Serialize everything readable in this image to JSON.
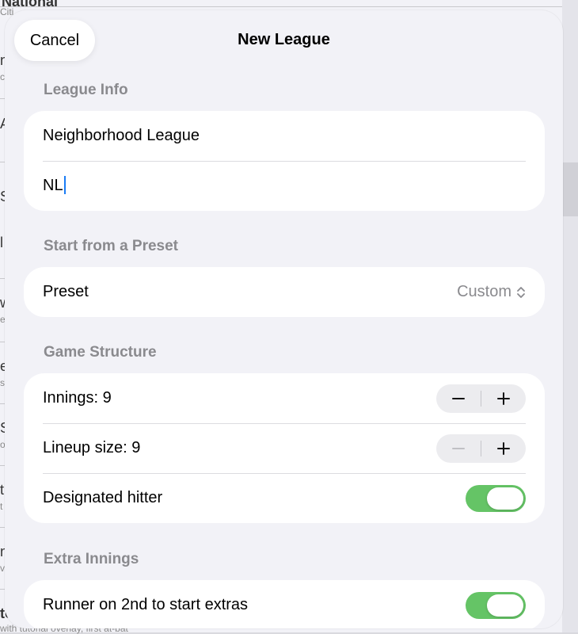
{
  "background": {
    "fragments": [
      "National",
      "n",
      "c",
      "A",
      "Citi",
      "S",
      "l",
      "w",
      "e",
      "e",
      "s",
      "S",
      "o",
      "t",
      "t",
      "n",
      "v",
      "to",
      "with tutorial overlay, first at-bat"
    ]
  },
  "sheet": {
    "title": "New League",
    "cancel_label": "Cancel"
  },
  "league_info": {
    "header": "League Info",
    "name_value": "Neighborhood League",
    "abbreviation_value": "NL"
  },
  "preset": {
    "header": "Start from a Preset",
    "label": "Preset",
    "value": "Custom"
  },
  "game_structure": {
    "header": "Game Structure",
    "innings_label": "Innings: 9",
    "innings": 9,
    "lineup_label": "Lineup size: 9",
    "lineup_size": 9,
    "dh_label": "Designated hitter",
    "dh_enabled": true
  },
  "extra_innings": {
    "header": "Extra Innings",
    "runner_label": "Runner on 2nd to start extras",
    "runner_enabled": true
  },
  "colors": {
    "toggle_on": "#65c466",
    "caret": "#1a7cf5",
    "secondary_text": "#8a8a8e"
  }
}
